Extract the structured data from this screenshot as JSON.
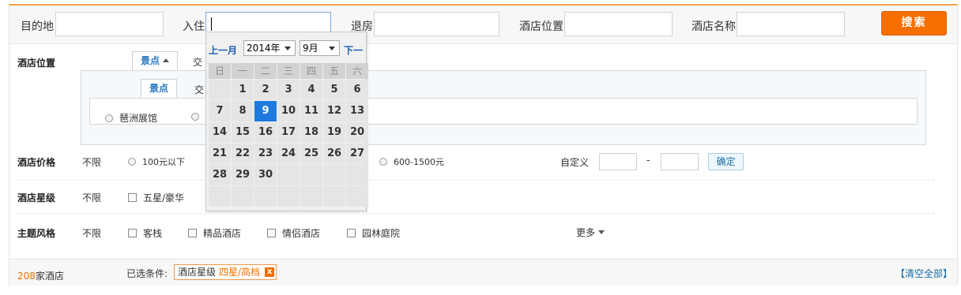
{
  "search": {
    "dest_label": "目的地",
    "dest_value": "",
    "checkin_label": "入住",
    "checkin_value": "",
    "checkout_label": "退房",
    "checkout_value": "",
    "location_label": "酒店位置",
    "location_value": "",
    "name_label": "酒店名称",
    "name_value": "",
    "search_button": "搜索"
  },
  "filters": {
    "location": {
      "label": "酒店位置",
      "tab_active": "景点",
      "tab_other": "交",
      "subtab_active": "景点",
      "subtab_other": "交",
      "options": [
        "琶洲展馆"
      ]
    },
    "price": {
      "label": "酒店价格",
      "none": "不限",
      "options": [
        "100元以下",
        "600-1500元"
      ],
      "custom_label": "自定义",
      "custom_dash": "-",
      "confirm": "确定"
    },
    "star": {
      "label": "酒店星级",
      "none": "不限",
      "options": [
        "五星/豪华"
      ]
    },
    "theme": {
      "label": "主题风格",
      "none": "不限",
      "options": [
        "客栈",
        "精品酒店",
        "情侣酒店",
        "园林庭院"
      ],
      "more": "更多"
    }
  },
  "results": {
    "count": "208",
    "count_suffix": "家酒店",
    "selected_label": "已选条件:",
    "tag_name": "酒店星级",
    "tag_value": "四星/高档",
    "tag_close": "x",
    "clear_all": "【清空全部】"
  },
  "calendar": {
    "prev": "上一月",
    "next": "下一",
    "year": "2014年",
    "month": "9月",
    "weekdays": [
      "日",
      "一",
      "二",
      "三",
      "四",
      "五",
      "六"
    ],
    "rows": [
      [
        "",
        "1",
        "2",
        "3",
        "4",
        "5",
        "6"
      ],
      [
        "7",
        "8",
        "9",
        "10",
        "11",
        "12",
        "13"
      ],
      [
        "14",
        "15",
        "16",
        "17",
        "18",
        "19",
        "20"
      ],
      [
        "21",
        "22",
        "23",
        "24",
        "25",
        "26",
        "27"
      ],
      [
        "28",
        "29",
        "30",
        "",
        "",
        "",
        ""
      ],
      [
        "",
        "",
        "",
        "",
        "",
        "",
        ""
      ]
    ],
    "selected_day": "9"
  },
  "colors": {
    "accent_orange": "#f56f00",
    "calendar_selected": "#1e7ae0",
    "link_blue": "#1a5fb4"
  }
}
